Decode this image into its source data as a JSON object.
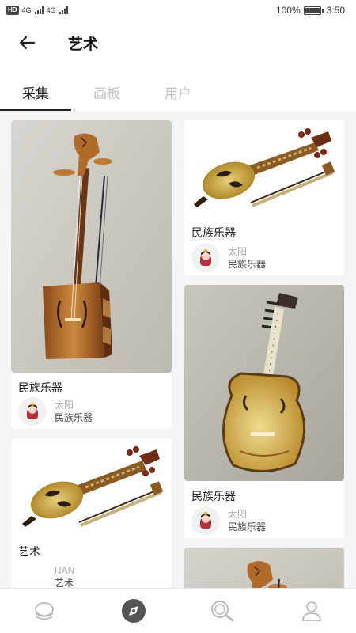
{
  "status_bar": {
    "hd": "HD",
    "net1": "4G",
    "net2": "4G",
    "battery_text": "100%",
    "time": "3:50",
    "battery_level": 1.0
  },
  "header": {
    "back_icon": "arrow-left-icon",
    "title": "艺术"
  },
  "tabs": [
    {
      "label": "采集",
      "active": true
    },
    {
      "label": "画板",
      "active": false
    },
    {
      "label": "用户",
      "active": false
    }
  ],
  "cards": [
    {
      "title": "民族乐器",
      "user": "太阳",
      "board": "民族乐器",
      "image": "morin-khuur-image"
    },
    {
      "title": "民族乐器",
      "user": "太阳",
      "board": "民族乐器",
      "image": "lute-with-bow-image"
    },
    {
      "title": "民族乐器",
      "user": "太阳",
      "board": "民族乐器",
      "image": "tobshuur-image"
    },
    {
      "title": "艺术",
      "user": "HAN",
      "board": "艺术",
      "image": "lute-with-bow-image"
    },
    {
      "title": "",
      "user": "",
      "board": "",
      "image": "horse-head-fiddle-image"
    }
  ],
  "bottom_nav": [
    {
      "name": "home",
      "icon": "home-stack-icon",
      "active": false
    },
    {
      "name": "discover",
      "icon": "compass-icon",
      "active": true
    },
    {
      "name": "search",
      "icon": "search-icon",
      "active": false
    },
    {
      "name": "profile",
      "icon": "user-icon",
      "active": false
    }
  ],
  "colors": {
    "active_tab": "#222222",
    "inactive_tab": "#c4c4c4",
    "feed_bg": "#f4f4f4",
    "nav_active": "#555555",
    "nav_inactive": "#bbbbbb"
  }
}
